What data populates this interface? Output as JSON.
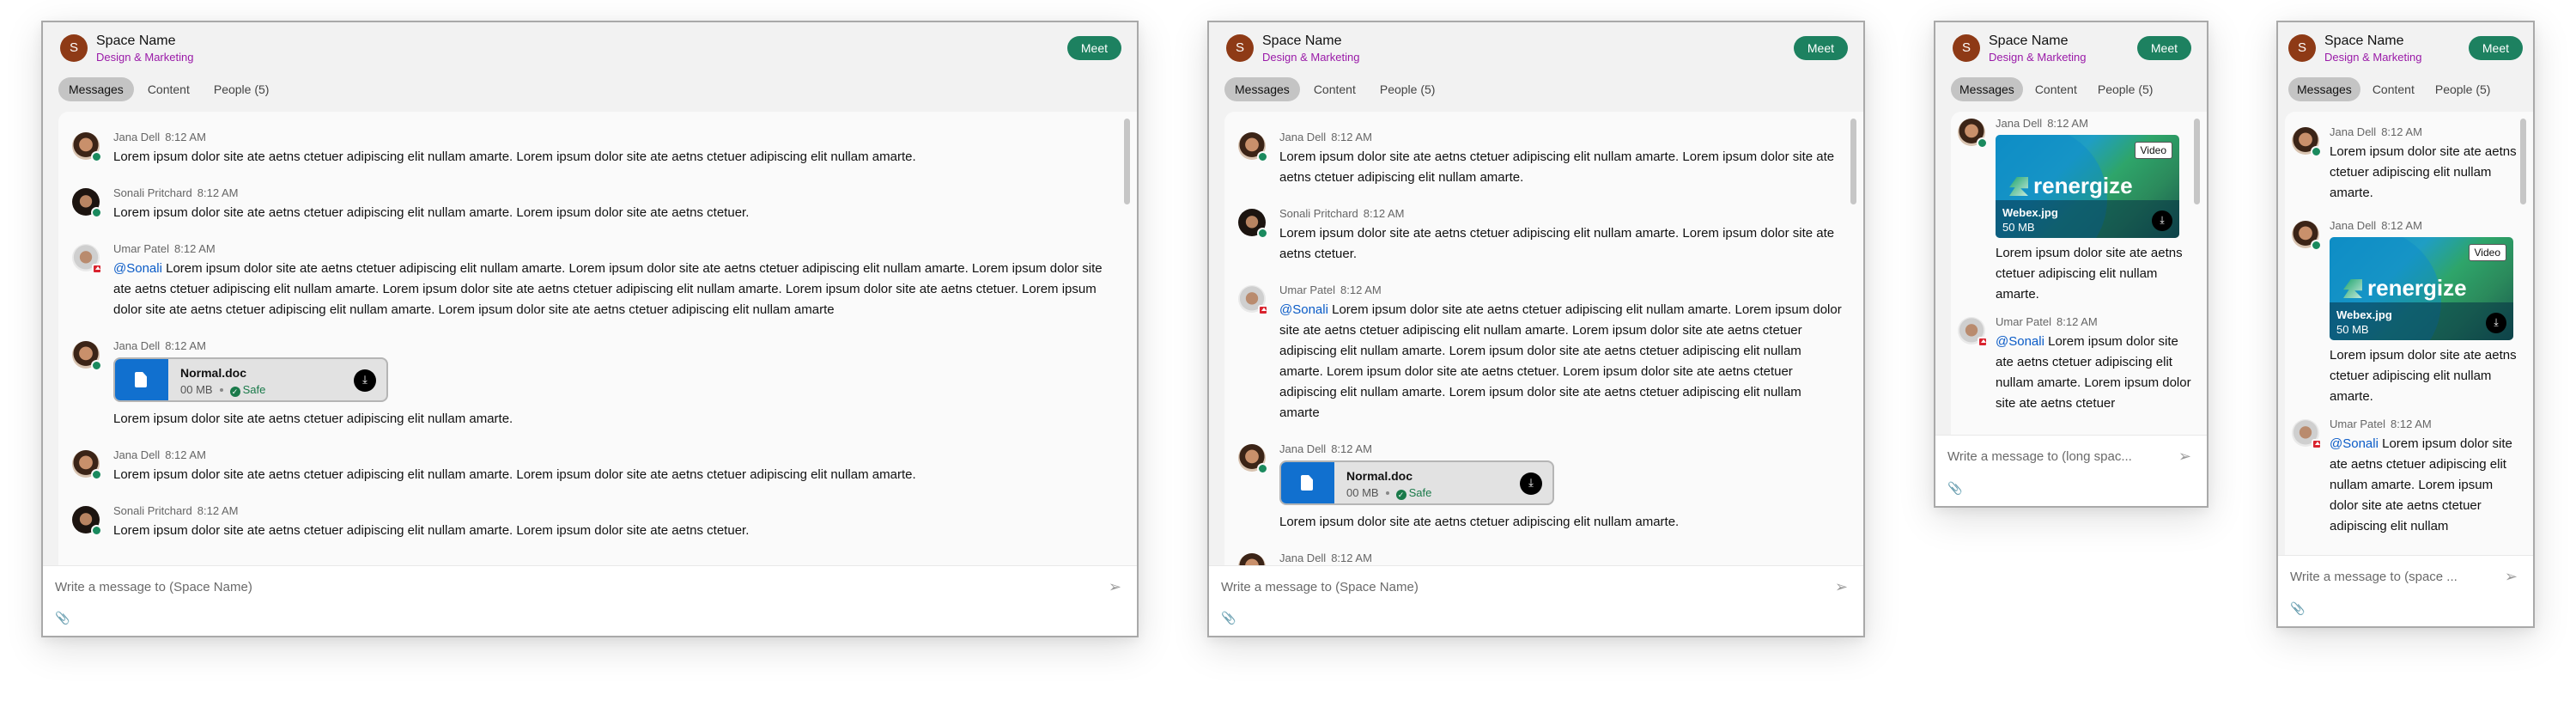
{
  "space": {
    "avatar_initial": "S",
    "title": "Space Name",
    "subtitle": "Design & Marketing",
    "meet_label": "Meet"
  },
  "tabs": [
    {
      "label": "Messages",
      "active": true
    },
    {
      "label": "Content",
      "active": false
    },
    {
      "label": "People (5)",
      "active": false
    }
  ],
  "colors": {
    "meet": "#1d8160",
    "subtitle": "#9a1aa8",
    "mention": "#0a5bc7",
    "file_icon": "#1170cf",
    "presence_active": "#1a8a5e",
    "presence_dnd": "#d9232e"
  },
  "attachments": {
    "doc": {
      "name": "Normal.doc",
      "size": "00 MB",
      "status": "Safe"
    },
    "media": {
      "name": "Webex.jpg",
      "size": "50 MB",
      "tag": "Video",
      "brand": "renergize"
    }
  },
  "panels": {
    "wide": {
      "messages": [
        {
          "sender": "Jana Dell",
          "time": "8:12 AM",
          "text": "Lorem ipsum dolor site ate aetns ctetuer adipiscing elit nullam amarte. Lorem ipsum dolor site ate aetns ctetuer adipiscing elit nullam amarte."
        },
        {
          "sender": "Sonali Pritchard",
          "time": "8:12 AM",
          "text": "Lorem ipsum dolor site ate aetns ctetuer adipiscing elit nullam amarte. Lorem ipsum dolor site ate aetns ctetuer."
        },
        {
          "sender": "Umar Patel",
          "time": "8:12 AM",
          "mention": "@Sonali",
          "text": "Lorem ipsum dolor site ate aetns ctetuer adipiscing elit nullam amarte. Lorem ipsum dolor site ate aetns ctetuer adipiscing elit nullam amarte. Lorem ipsum dolor site ate aetns ctetuer adipiscing elit nullam amarte. Lorem ipsum dolor site ate aetns ctetuer adipiscing elit nullam amarte. Lorem ipsum dolor site ate aetns ctetuer. Lorem ipsum dolor site ate aetns ctetuer adipiscing elit nullam amarte. Lorem ipsum dolor site ate aetns ctetuer adipiscing elit nullam amarte"
        },
        {
          "sender": "Jana Dell",
          "time": "8:12 AM",
          "text": "Lorem ipsum dolor site ate aetns ctetuer adipiscing elit nullam amarte."
        },
        {
          "sender": "Jana Dell",
          "time": "8:12 AM",
          "text": "Lorem ipsum dolor site ate aetns ctetuer adipiscing elit nullam amarte. Lorem ipsum dolor site ate aetns ctetuer adipiscing elit nullam amarte."
        },
        {
          "sender": "Sonali Pritchard",
          "time": "8:12 AM",
          "text": "Lorem ipsum dolor site ate aetns ctetuer adipiscing elit nullam amarte. Lorem ipsum dolor site ate aetns ctetuer."
        }
      ],
      "composer_placeholder": "Write a message to (Space Name)"
    },
    "medium": {
      "composer_placeholder": "Write a message to (Space Name)"
    },
    "small": {
      "messages": [
        {
          "sender": "Jana Dell",
          "time": "8:12 AM",
          "text": "Lorem ipsum dolor site ate aetns ctetuer adipiscing elit nullam amarte."
        },
        {
          "sender": "Umar Patel",
          "time": "8:12 AM",
          "mention": "@Sonali",
          "text": "Lorem ipsum dolor site ate aetns ctetuer adipiscing elit nullam amarte. Lorem ipsum dolor site ate aetns ctetuer"
        }
      ],
      "composer_placeholder": "Write a message to (long spac..."
    },
    "narrow": {
      "messages": [
        {
          "sender": "Jana Dell",
          "time": "8:12 AM",
          "text": "Lorem ipsum dolor site ate aetns ctetuer adipiscing elit nullam amarte."
        },
        {
          "sender": "Jana Dell",
          "time": "8:12 AM",
          "text": "Lorem ipsum dolor site ate aetns ctetuer adipiscing elit nullam amarte."
        },
        {
          "sender": "Umar Patel",
          "time": "8:12 AM",
          "mention": "@Sonali",
          "text": "Lorem ipsum dolor site ate aetns ctetuer adipiscing elit nullam amarte. Lorem ipsum dolor site ate aetns ctetuer adipiscing elit nullam"
        }
      ],
      "composer_placeholder": "Write a message to (space ..."
    }
  },
  "icons": {
    "send": "➢",
    "attach": "📎",
    "download": "⤓",
    "check": "✓"
  }
}
